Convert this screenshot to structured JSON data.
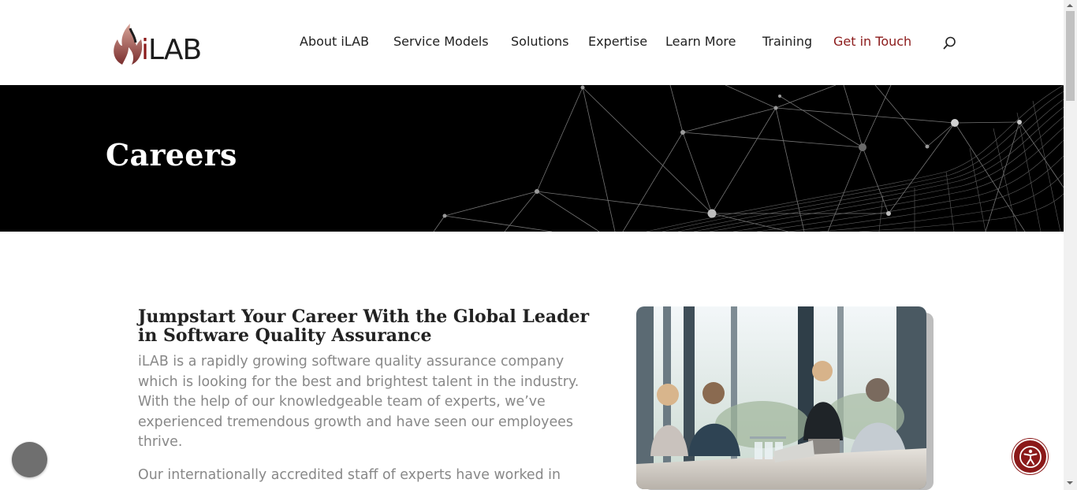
{
  "header": {
    "logo_text_i": "i",
    "logo_text_rest": "LAB",
    "nav": [
      {
        "label": "About iLAB",
        "accent": false
      },
      {
        "label": "Service Models",
        "accent": false
      },
      {
        "label": "Solutions",
        "accent": false
      },
      {
        "label": "Expertise",
        "accent": false
      },
      {
        "label": "Learn More",
        "accent": false
      },
      {
        "label": "Training",
        "accent": false
      },
      {
        "label": "Get in Touch",
        "accent": true
      }
    ],
    "search_icon": "search-icon"
  },
  "hero": {
    "title": "Careers"
  },
  "main": {
    "heading": "Jumpstart Your Career With the Global Leader in Software Quality Assurance",
    "paragraph1": "iLAB is a rapidly growing software quality assurance company which is looking for the best and brightest talent in the industry. With the help of our knowledgeable team of experts, we’ve experienced tremendous growth and have seen our employees thrive.",
    "paragraph2": "Our internationally accredited staff of experts have worked in over"
  },
  "widgets": {
    "chat_icon": "chat-icon",
    "accessibility_icon": "accessibility-icon"
  },
  "colors": {
    "accent": "#8b1a1a",
    "hero_bg": "#000000",
    "body_text": "#888888",
    "heading_text": "#222222"
  }
}
